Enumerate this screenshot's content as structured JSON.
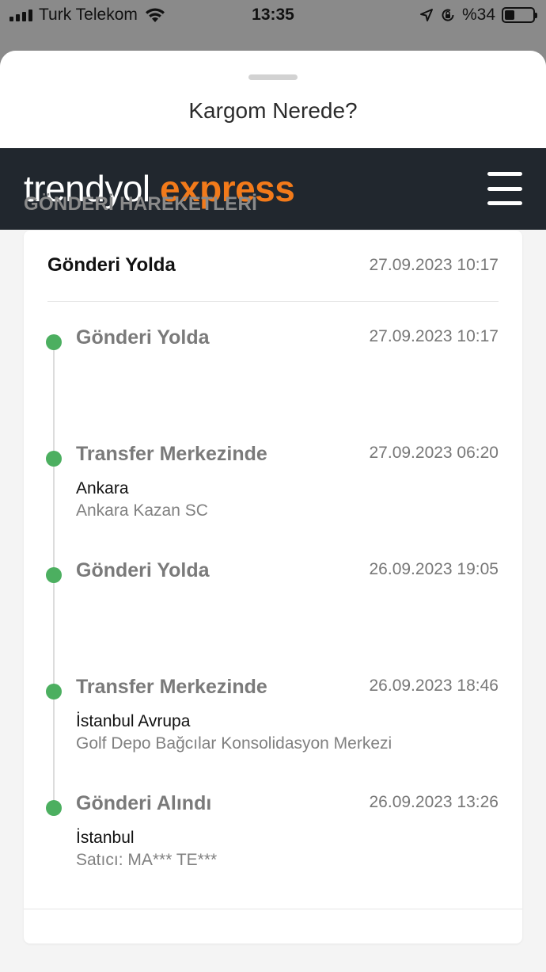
{
  "status_bar": {
    "carrier": "Turk Telekom",
    "time": "13:35",
    "battery": "%34",
    "battery_level_percent": 34,
    "icons": [
      "signal-icon",
      "wifi-icon",
      "location-arrow-icon",
      "rotation-lock-icon",
      "battery-icon"
    ]
  },
  "sheet": {
    "title": "Kargom Nerede?"
  },
  "brand": {
    "logo_part1": "trendyol",
    "logo_part2": "express",
    "accent_color": "#f27a1a",
    "bar_color": "#21272e"
  },
  "section": {
    "title": "GÖNDERİ HAREKETLERİ"
  },
  "summary": {
    "status": "Gönderi Yolda",
    "date": "27.09.2023 10:17"
  },
  "events": [
    {
      "title": "Gönderi Yolda",
      "date": "27.09.2023 10:17",
      "location": "",
      "detail": ""
    },
    {
      "title": "Transfer Merkezinde",
      "date": "27.09.2023 06:20",
      "location": "Ankara",
      "detail": "Ankara Kazan SC"
    },
    {
      "title": "Gönderi Yolda",
      "date": "26.09.2023 19:05",
      "location": "",
      "detail": ""
    },
    {
      "title": "Transfer Merkezinde",
      "date": "26.09.2023 18:46",
      "location": "İstanbul Avrupa",
      "detail": "Golf Depo Bağcılar Konsolidasyon Merkezi"
    },
    {
      "title": "Gönderi Alındı",
      "date": "26.09.2023 13:26",
      "location": "İstanbul",
      "detail": "Satıcı: MA*** TE***"
    }
  ],
  "status_color": "#4caf60"
}
